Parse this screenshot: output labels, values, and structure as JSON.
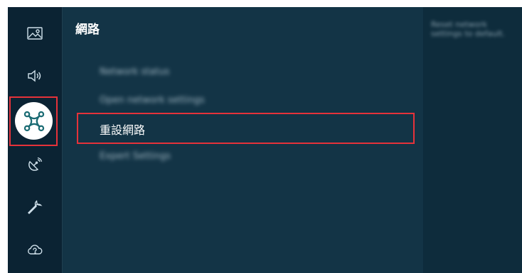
{
  "sidebar": {
    "items": [
      {
        "icon": "picture-icon"
      },
      {
        "icon": "sound-icon"
      },
      {
        "icon": "network-icon",
        "selected": true
      },
      {
        "icon": "satellite-dish-icon"
      },
      {
        "icon": "wrench-icon"
      },
      {
        "icon": "support-cloud-icon"
      }
    ]
  },
  "panel": {
    "title": "網路",
    "items": [
      {
        "label": "Network status",
        "blurred": true
      },
      {
        "label": "Open network settings",
        "blurred": true
      },
      {
        "label": "重設網路",
        "blurred": false,
        "active": true
      },
      {
        "label": "Expert Settings",
        "blurred": true
      }
    ]
  },
  "description": {
    "text": "Reset network settings to default."
  },
  "colors": {
    "highlight": "#e6323a",
    "background": "#133446",
    "sidebar": "#0b2333"
  }
}
